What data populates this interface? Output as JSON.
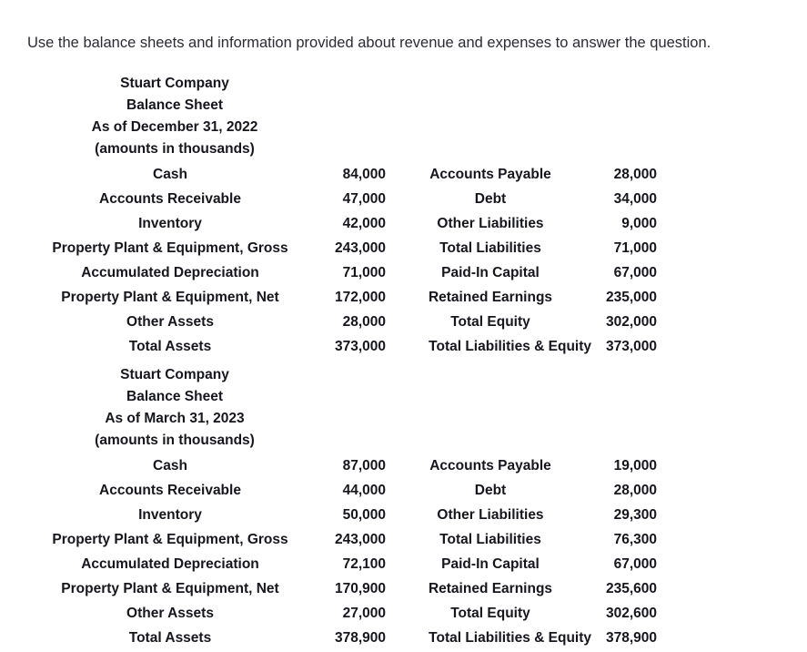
{
  "intro": {
    "text": "Use the balance sheets and information provided about revenue and expenses to answer the question."
  },
  "sheets": [
    {
      "company": "Stuart Company",
      "statement": "Balance Sheet",
      "date": "As of December 31, 2022",
      "units": "(amounts in thousands)",
      "rows": [
        {
          "asset_label": "Cash",
          "asset_value": "84,000",
          "liab_label": "Accounts Payable",
          "liab_value": "28,000"
        },
        {
          "asset_label": "Accounts Receivable",
          "asset_value": "47,000",
          "liab_label": "Debt",
          "liab_value": "34,000"
        },
        {
          "asset_label": "Inventory",
          "asset_value": "42,000",
          "liab_label": "Other Liabilities",
          "liab_value": "9,000"
        },
        {
          "asset_label": "Property Plant & Equipment, Gross",
          "asset_value": "243,000",
          "liab_label": "Total Liabilities",
          "liab_value": "71,000"
        },
        {
          "asset_label": "Accumulated Depreciation",
          "asset_value": "71,000",
          "liab_label": "Paid-In Capital",
          "liab_value": "67,000"
        },
        {
          "asset_label": "Property Plant & Equipment, Net",
          "asset_value": "172,000",
          "liab_label": "Retained Earnings",
          "liab_value": "235,000"
        },
        {
          "asset_label": "Other Assets",
          "asset_value": "28,000",
          "liab_label": "Total Equity",
          "liab_value": "302,000"
        },
        {
          "asset_label": "Total Assets",
          "asset_value": "373,000",
          "liab_label": "Total Liabilities & Equity",
          "liab_value": "373,000"
        }
      ]
    },
    {
      "company": "Stuart Company",
      "statement": "Balance Sheet",
      "date": "As of March 31, 2023",
      "units": "(amounts in thousands)",
      "rows": [
        {
          "asset_label": "Cash",
          "asset_value": "87,000",
          "liab_label": "Accounts Payable",
          "liab_value": "19,000"
        },
        {
          "asset_label": "Accounts Receivable",
          "asset_value": "44,000",
          "liab_label": "Debt",
          "liab_value": "28,000"
        },
        {
          "asset_label": "Inventory",
          "asset_value": "50,000",
          "liab_label": "Other Liabilities",
          "liab_value": "29,300"
        },
        {
          "asset_label": "Property Plant & Equipment, Gross",
          "asset_value": "243,000",
          "liab_label": "Total Liabilities",
          "liab_value": "76,300"
        },
        {
          "asset_label": "Accumulated Depreciation",
          "asset_value": "72,100",
          "liab_label": "Paid-In Capital",
          "liab_value": "67,000"
        },
        {
          "asset_label": "Property Plant & Equipment, Net",
          "asset_value": "170,900",
          "liab_label": "Retained Earnings",
          "liab_value": "235,600"
        },
        {
          "asset_label": "Other Assets",
          "asset_value": "27,000",
          "liab_label": "Total Equity",
          "liab_value": "302,600"
        },
        {
          "asset_label": "Total Assets",
          "asset_value": "378,900",
          "liab_label": "Total Liabilities & Equity",
          "liab_value": "378,900"
        }
      ]
    }
  ]
}
